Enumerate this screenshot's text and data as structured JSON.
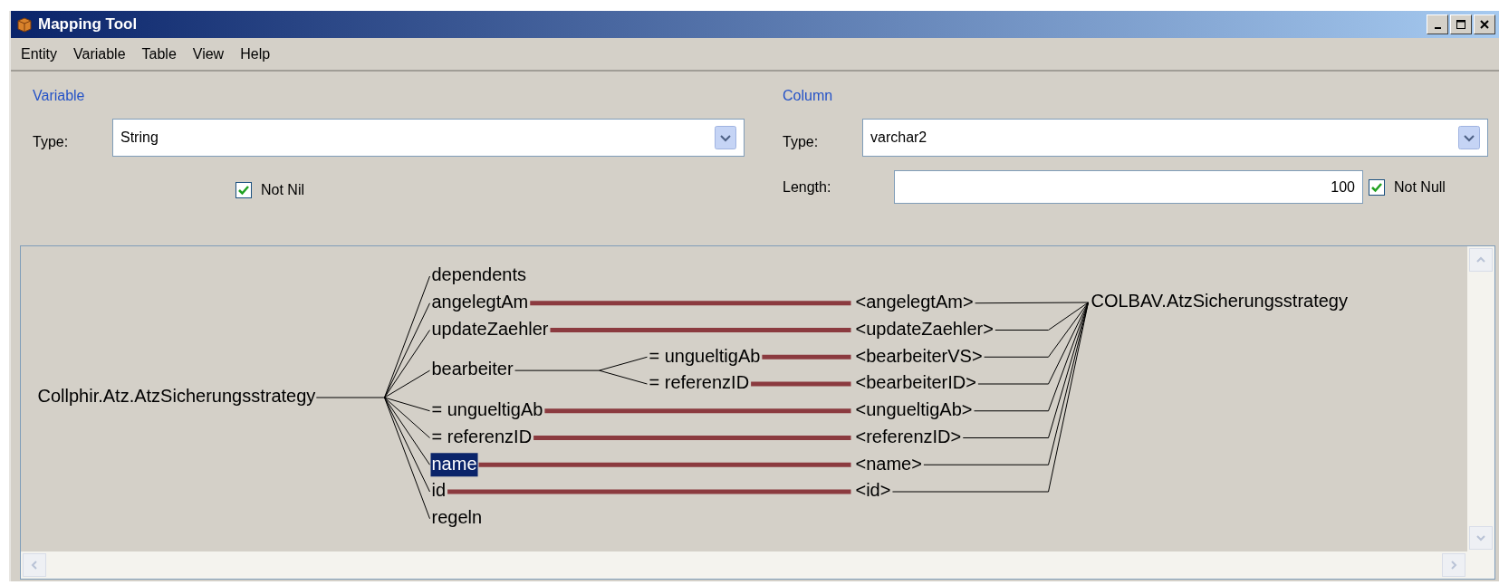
{
  "window": {
    "title": "Mapping Tool"
  },
  "menu": [
    "Entity",
    "Variable",
    "Table",
    "View",
    "Help"
  ],
  "variable": {
    "heading": "Variable",
    "type_label": "Type:",
    "type_value": "String",
    "not_nil": {
      "label": "Not Nil",
      "checked": true
    }
  },
  "column": {
    "heading": "Column",
    "type_label": "Type:",
    "type_value": "varchar2",
    "length_label": "Length:",
    "length_value": "100",
    "not_null": {
      "label": "Not Null",
      "checked": true
    }
  },
  "mapping": {
    "source": "Collphir.Atz.AtzSicherungsstrategy",
    "target": "COLBAV.AtzSicherungsstrategy",
    "attributes": [
      {
        "label": "dependents",
        "selected": false
      },
      {
        "label": "angelegtAm",
        "selected": false,
        "column": "<angelegtAm>"
      },
      {
        "label": "updateZaehler",
        "selected": false,
        "column": "<updateZaehler>"
      },
      {
        "label": "bearbeiter",
        "selected": false,
        "children": [
          {
            "label": "= ungueltigAb",
            "selected": false,
            "column": "<bearbeiterVS>"
          },
          {
            "label": "= referenzID",
            "selected": false,
            "column": "<bearbeiterID>"
          }
        ]
      },
      {
        "label": "= ungueltigAb",
        "selected": false,
        "column": "<ungueltigAb>"
      },
      {
        "label": "= referenzID",
        "selected": false,
        "column": "<referenzID>"
      },
      {
        "label": "name",
        "selected": true,
        "column": "<name>"
      },
      {
        "label": "id",
        "selected": false,
        "column": "<id>"
      },
      {
        "label": "regeln",
        "selected": false
      }
    ]
  }
}
